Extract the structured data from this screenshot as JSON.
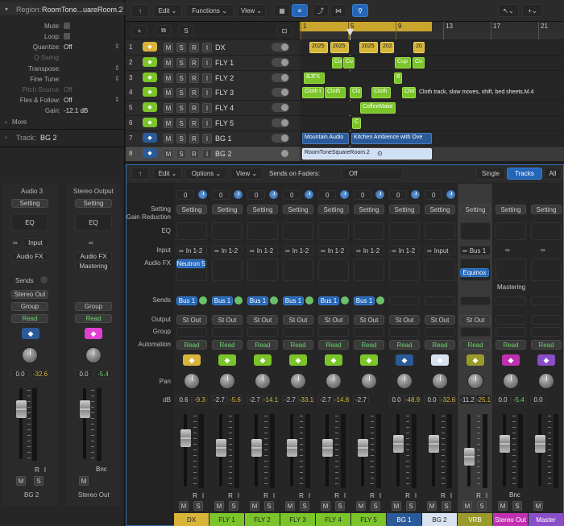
{
  "inspector": {
    "region_label": "Region:",
    "region_name": "RoomTone...uareRoom.2",
    "mute": "Mute:",
    "loop": "Loop:",
    "quantize": "Quantize:",
    "quantize_val": "Off",
    "qswing": "Q-Swing:",
    "transpose": "Transpose:",
    "finetune": "Fine Tune:",
    "pitch": "Pitch Source:",
    "pitch_val": "Off",
    "flex": "Flex & Follow:",
    "flex_val": "Off",
    "gain": "Gain:",
    "gain_val": "-12.1 dB",
    "more": "More",
    "track_label": "Track:",
    "track_name": "BG 2",
    "strip1": {
      "name": "Audio 3",
      "setting": "Setting",
      "eq": "EQ",
      "input": "Input",
      "fx": "Audio FX",
      "sends": "Sends",
      "out": "Stereo Out",
      "group": "Group",
      "auto": "Read",
      "v1": "0.0",
      "v2": "-32.6",
      "bottom": "BG 2"
    },
    "strip2": {
      "name": "Stereo Output",
      "setting": "Setting",
      "eq": "EQ",
      "fx1": "Audio FX",
      "fx2": "Mastering",
      "group": "Group",
      "auto": "Read",
      "v1": "0.0",
      "v2": "-5.4",
      "bnc": "Bnc",
      "bottom": "Stereo Out"
    }
  },
  "toolbar": {
    "edit": "Edit",
    "functions": "Functions",
    "view": "View"
  },
  "ruler": [
    "1",
    "5",
    "9",
    "13",
    "17",
    "21"
  ],
  "tracks": [
    {
      "num": "1",
      "name": "DX",
      "color": "#d9b43a"
    },
    {
      "num": "2",
      "name": "FLY 1",
      "color": "#7bc42a"
    },
    {
      "num": "3",
      "name": "FLY 2",
      "color": "#7bc42a"
    },
    {
      "num": "4",
      "name": "FLY 3",
      "color": "#7bc42a"
    },
    {
      "num": "5",
      "name": "FLY 4",
      "color": "#7bc42a"
    },
    {
      "num": "6",
      "name": "FLY 5",
      "color": "#7bc42a"
    },
    {
      "num": "7",
      "name": "BG 1",
      "color": "#2b5a99"
    },
    {
      "num": "8",
      "name": "BG 2",
      "color": "#2b5a99"
    }
  ],
  "regions": {
    "dx": [
      "2025",
      "2025",
      "2025",
      "202",
      "20"
    ],
    "fly1": [
      "Cup",
      "Cu",
      "Cup",
      "Cu"
    ],
    "fly2": [
      "BJFX",
      "B"
    ],
    "fly3": [
      "Cloth t",
      "Cloth",
      "Clo",
      "Cloth",
      "Clot"
    ],
    "fly3_note": "Cloth track, slow moves, shift, bed sheets.M.4",
    "fly4": "CoffeeMake",
    "fly5": "C",
    "bg1a": "Mountain Audio",
    "bg1b": "Kitchen Ambience with Ove",
    "bg2": "RoomToneSquareRoom.2"
  },
  "mixer": {
    "edit": "Edit",
    "options": "Options",
    "view": "View",
    "sends_on_faders": "Sends on Faders:",
    "sends_val": "Off",
    "single": "Single",
    "tracks": "Tracks",
    "all": "All",
    "labels": {
      "setting": "Setting",
      "gain": "Gain Reduction",
      "eq": "EQ",
      "input": "Input",
      "fx": "Audio FX",
      "sends": "Sends",
      "output": "Output",
      "group": "Group",
      "automation": "Automation",
      "pan": "Pan",
      "db": "dB"
    },
    "channels": [
      {
        "name": "DX",
        "color": "#d9b43a",
        "txt": "#222",
        "trim": "0",
        "input": "In 1-2",
        "fx": "Neutron 5",
        "send": "Bus 1",
        "out": "St Out",
        "auto": "Read",
        "v1": "0.6",
        "v2": "-9.3",
        "fader": 0.72
      },
      {
        "name": "FLY 1",
        "color": "#7bc42a",
        "txt": "#222",
        "trim": "0",
        "input": "In 1-2",
        "fx": "",
        "send": "Bus 1",
        "out": "St Out",
        "auto": "Read",
        "v1": "-2.7",
        "v2": "-5.6",
        "fader": 0.55
      },
      {
        "name": "FLY 2",
        "color": "#7bc42a",
        "txt": "#222",
        "trim": "0",
        "input": "In 1-2",
        "fx": "",
        "send": "Bus 1",
        "out": "St Out",
        "auto": "Read",
        "v1": "-2.7",
        "v2": "-14.1",
        "fader": 0.55
      },
      {
        "name": "FLY 3",
        "color": "#7bc42a",
        "txt": "#222",
        "trim": "0",
        "input": "In 1-2",
        "fx": "",
        "send": "Bus 1",
        "out": "St Out",
        "auto": "Read",
        "v1": "-2.7",
        "v2": "-33.1",
        "fader": 0.55
      },
      {
        "name": "FLY 4",
        "color": "#7bc42a",
        "txt": "#222",
        "trim": "0",
        "input": "In 1-2",
        "fx": "",
        "send": "Bus 1",
        "out": "St Out",
        "auto": "Read",
        "v1": "-2.7",
        "v2": "-14.8",
        "fader": 0.55
      },
      {
        "name": "FLY 5",
        "color": "#7bc42a",
        "txt": "#222",
        "trim": "0",
        "input": "In 1-2",
        "fx": "",
        "send": "Bus 1",
        "out": "St Out",
        "auto": "Read",
        "v1": "-2.7",
        "v2": "",
        "fader": 0.55
      },
      {
        "name": "BG 1",
        "color": "#2b5a99",
        "txt": "#fff",
        "trim": "0",
        "input": "In 1-2",
        "fx": "",
        "send": "",
        "out": "St Out",
        "auto": "Read",
        "v1": "0.0",
        "v2": "-48.9",
        "fader": 0.62
      },
      {
        "name": "BG 2",
        "color": "#d8e2f0",
        "txt": "#222",
        "trim": "0",
        "input": "Input",
        "fx": "",
        "send": "",
        "out": "St Out",
        "auto": "Read",
        "v1": "0.0",
        "v2": "-32.6",
        "fader": 0.62
      },
      {
        "name": "VRB",
        "color": "#9a9a2a",
        "txt": "#fff",
        "trim": "",
        "input": "Bus 1",
        "fx": "Equinox",
        "send": "",
        "out": "St Out",
        "auto": "Read",
        "v1": "-11.2",
        "v2": "-25.1",
        "fader": 0.38
      },
      {
        "name": "Stereo Out",
        "color": "#c02fb0",
        "txt": "#fff",
        "trim": "",
        "input": "",
        "fx": "Mastering",
        "send": "",
        "out": "",
        "auto": "Read",
        "v1": "0.0",
        "v2": "-5.4",
        "fader": 0.62
      },
      {
        "name": "Master",
        "color": "#8a4ec8",
        "txt": "#fff",
        "trim": "",
        "input": "",
        "fx": "",
        "send": "",
        "out": "",
        "auto": "Read",
        "v1": "0.0",
        "v2": "",
        "fader": 0.62
      }
    ]
  }
}
